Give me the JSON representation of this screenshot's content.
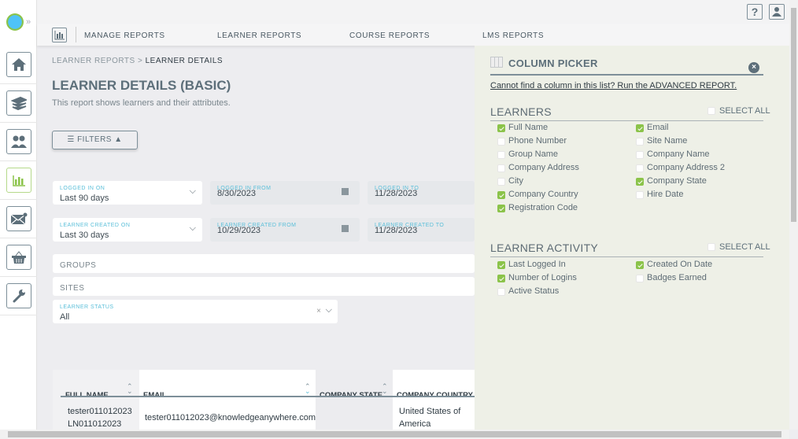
{
  "sidebar": {
    "items": [
      {
        "name": "home",
        "icon": "home-icon"
      },
      {
        "name": "courses",
        "icon": "books-icon"
      },
      {
        "name": "users",
        "icon": "users-icon"
      },
      {
        "name": "reports",
        "icon": "bar-chart-icon",
        "active": true
      },
      {
        "name": "messages",
        "icon": "mail-icon"
      },
      {
        "name": "store",
        "icon": "basket-icon"
      },
      {
        "name": "settings",
        "icon": "wrench-icon"
      }
    ]
  },
  "nav": {
    "manage": "MANAGE REPORTS",
    "learner": "LEARNER REPORTS",
    "course": "COURSE REPORTS",
    "lms": "LMS REPORTS"
  },
  "breadcrumb": {
    "parent": "LEARNER REPORTS",
    "sep": ">",
    "current": "LEARNER DETAILS"
  },
  "page": {
    "title": "LEARNER DETAILS (BASIC)",
    "subtitle": "This report shows learners and their attributes."
  },
  "filters_label": "FILTERS",
  "filters": {
    "logged_in_on": {
      "label": "LOGGED IN ON",
      "value": "Last 90 days"
    },
    "logged_in_from": {
      "label": "LOGGED IN FROM",
      "value": "8/30/2023"
    },
    "logged_in_to": {
      "label": "LOGGED IN TO",
      "value": "11/28/2023"
    },
    "created_on": {
      "label": "LEARNER CREATED ON",
      "value": "Last 30 days"
    },
    "created_from": {
      "label": "LEARNER CREATED FROM",
      "value": "10/29/2023"
    },
    "created_to": {
      "label": "LEARNER CREATED TO",
      "value": "11/28/2023"
    },
    "groups": "GROUPS",
    "sites": "SITES",
    "status": {
      "label": "LEARNER STATUS",
      "value": "All"
    }
  },
  "picker": {
    "title": "COLUMN PICKER",
    "link": "Cannot find a column in this list? Run the ADVANCED REPORT.",
    "select_all": "SELECT ALL",
    "learners": {
      "title": "LEARNERS",
      "items": [
        {
          "label": "Full Name",
          "checked": true
        },
        {
          "label": "Email",
          "checked": true
        },
        {
          "label": "Phone Number",
          "checked": false
        },
        {
          "label": "Site Name",
          "checked": false
        },
        {
          "label": "Group Name",
          "checked": false
        },
        {
          "label": "Company Name",
          "checked": false
        },
        {
          "label": "Company Address",
          "checked": false
        },
        {
          "label": "Company Address 2",
          "checked": false
        },
        {
          "label": "City",
          "checked": false
        },
        {
          "label": "Company State",
          "checked": true
        },
        {
          "label": "Company Country",
          "checked": true
        },
        {
          "label": "Hire Date",
          "checked": false
        },
        {
          "label": "Registration Code",
          "checked": true
        }
      ]
    },
    "activity": {
      "title": "LEARNER ACTIVITY",
      "items": [
        {
          "label": "Last Logged In",
          "checked": true
        },
        {
          "label": "Created On Date",
          "checked": true
        },
        {
          "label": "Number of Logins",
          "checked": true
        },
        {
          "label": "Badges Earned",
          "checked": false
        },
        {
          "label": "Active Status",
          "checked": false
        }
      ]
    }
  },
  "table": {
    "headers": [
      "FULL NAME",
      "EMAIL",
      "COMPANY STATE",
      "COMPANY COUNTRY"
    ],
    "rows": [
      {
        "full_name_1": "tester011012023",
        "full_name_2": "LN011012023",
        "email": "tester011012023@knowledgeanywhere.com",
        "state": "",
        "country_1": "United States of",
        "country_2": "America"
      }
    ]
  },
  "colors": {
    "accent": "#8bc34a",
    "label": "#5bbfd9",
    "text": "#4a5963"
  }
}
